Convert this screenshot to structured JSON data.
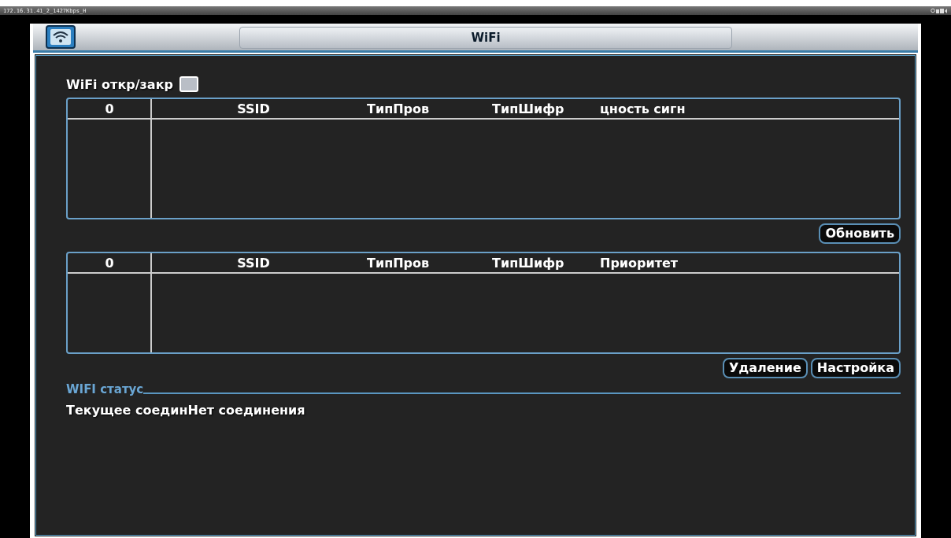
{
  "status_bar": {
    "stream": "172.16.31.41_2_1427Kbps_H"
  },
  "window": {
    "title": "WiFi"
  },
  "wifi_toggle": {
    "label": "WiFi откр/закр",
    "checked": false
  },
  "scan_table": {
    "columns": [
      "0",
      "SSID",
      "ТипПров",
      "ТипШифр",
      "цность сигн"
    ]
  },
  "refresh_button": "Обновить",
  "saved_table": {
    "columns": [
      "0",
      "SSID",
      "ТипПров",
      "ТипШифр",
      "Приоритет"
    ]
  },
  "buttons": [
    "Удаление",
    "Настройка"
  ],
  "status": {
    "heading": "WIFI статус",
    "label": "Текущее соедин",
    "value": "Нет соединения"
  }
}
